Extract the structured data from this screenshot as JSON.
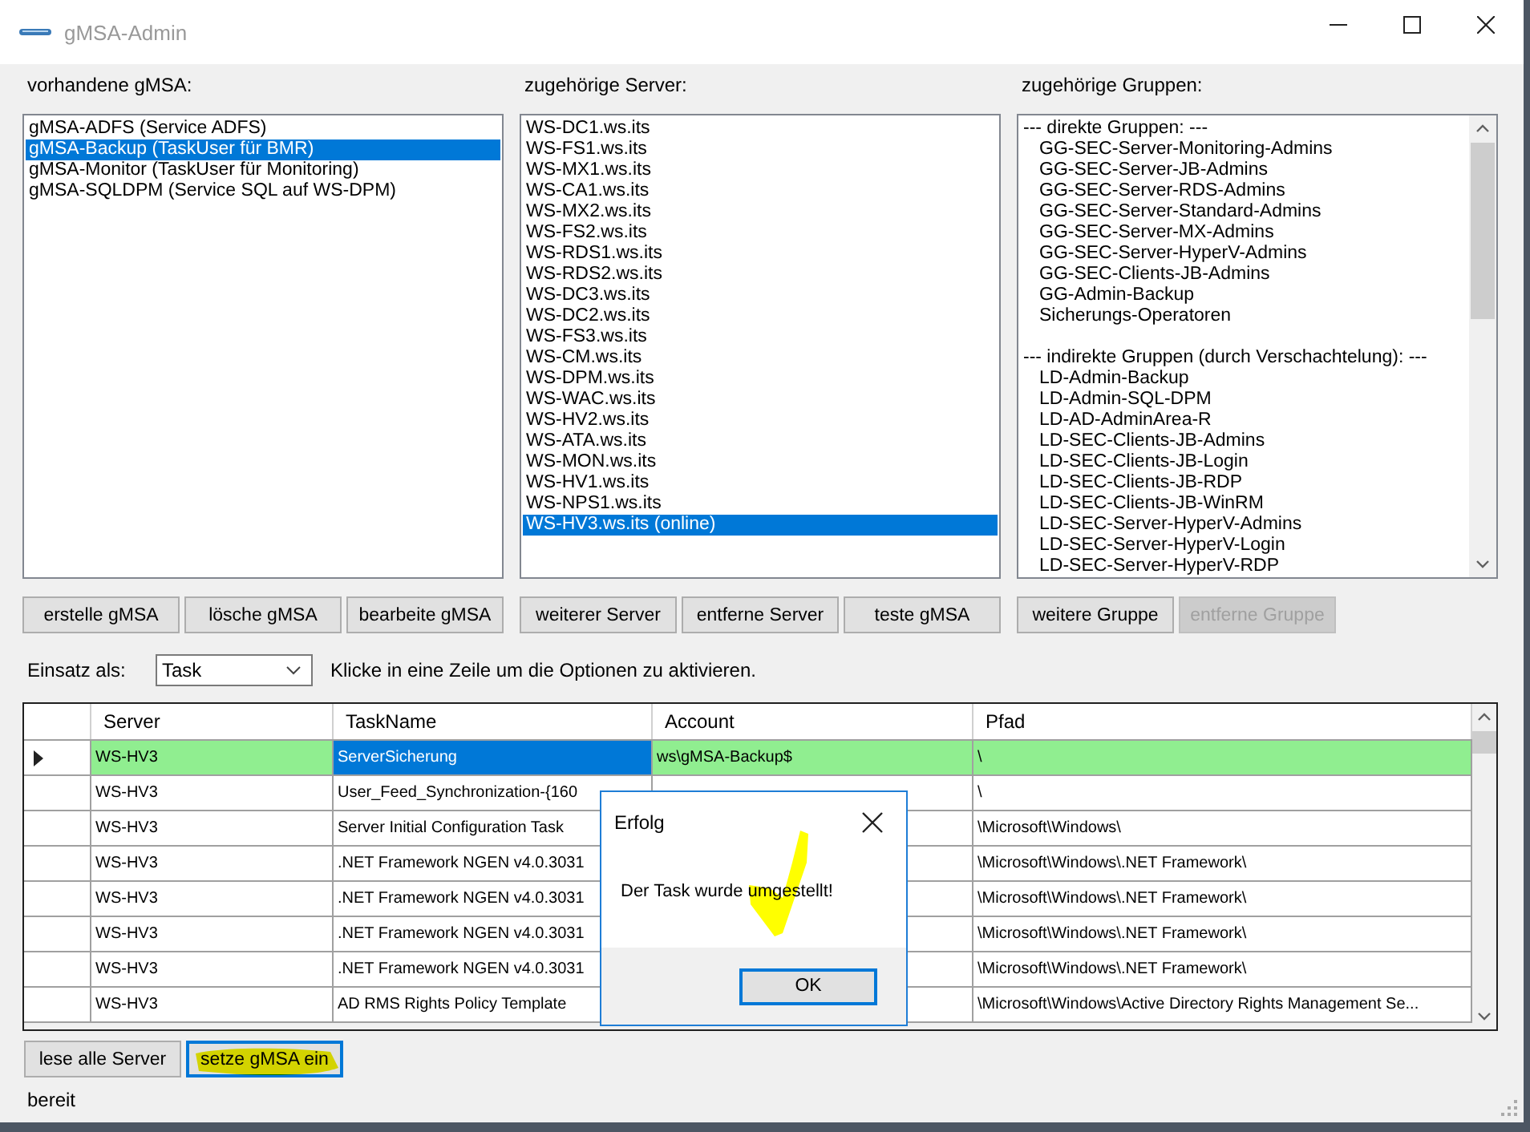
{
  "window": {
    "title": "gMSA-Admin"
  },
  "gmsa": {
    "label": "vorhandene gMSA:",
    "items": [
      {
        "text": "gMSA-ADFS (Service ADFS)",
        "selected": false
      },
      {
        "text": "gMSA-Backup (TaskUser für BMR)",
        "selected": true
      },
      {
        "text": "gMSA-Monitor (TaskUser für Monitoring)",
        "selected": false
      },
      {
        "text": "gMSA-SQLDPM (Service SQL auf WS-DPM)",
        "selected": false
      }
    ],
    "buttons": [
      {
        "label": "erstelle gMSA",
        "disabled": false
      },
      {
        "label": "lösche gMSA",
        "disabled": false
      },
      {
        "label": "bearbeite gMSA",
        "disabled": false
      }
    ]
  },
  "servers": {
    "label": "zugehörige Server:",
    "items": [
      {
        "text": "WS-DC1.ws.its",
        "selected": false
      },
      {
        "text": "WS-FS1.ws.its",
        "selected": false
      },
      {
        "text": "WS-MX1.ws.its",
        "selected": false
      },
      {
        "text": "WS-CA1.ws.its",
        "selected": false
      },
      {
        "text": "WS-MX2.ws.its",
        "selected": false
      },
      {
        "text": "WS-FS2.ws.its",
        "selected": false
      },
      {
        "text": "WS-RDS1.ws.its",
        "selected": false
      },
      {
        "text": "WS-RDS2.ws.its",
        "selected": false
      },
      {
        "text": "WS-DC3.ws.its",
        "selected": false
      },
      {
        "text": "WS-DC2.ws.its",
        "selected": false
      },
      {
        "text": "WS-FS3.ws.its",
        "selected": false
      },
      {
        "text": "WS-CM.ws.its",
        "selected": false
      },
      {
        "text": "WS-DPM.ws.its",
        "selected": false
      },
      {
        "text": "WS-WAC.ws.its",
        "selected": false
      },
      {
        "text": "WS-HV2.ws.its",
        "selected": false
      },
      {
        "text": "WS-ATA.ws.its",
        "selected": false
      },
      {
        "text": "WS-MON.ws.its",
        "selected": false
      },
      {
        "text": "WS-HV1.ws.its",
        "selected": false
      },
      {
        "text": "WS-NPS1.ws.its",
        "selected": false
      },
      {
        "text": "WS-HV3.ws.its (online)",
        "selected": true
      }
    ],
    "buttons": [
      {
        "label": "weiterer Server",
        "disabled": false
      },
      {
        "label": "entferne Server",
        "disabled": false
      },
      {
        "label": "teste gMSA",
        "disabled": false
      }
    ]
  },
  "groups": {
    "label": "zugehörige Gruppen:",
    "items": [
      {
        "text": "--- direkte Gruppen: ---",
        "children": [
          {
            "text": "GG-SEC-Server-Monitoring-Admins"
          },
          {
            "text": "GG-SEC-Server-JB-Admins"
          },
          {
            "text": "GG-SEC-Server-RDS-Admins"
          },
          {
            "text": "GG-SEC-Server-Standard-Admins"
          },
          {
            "text": "GG-SEC-Server-MX-Admins"
          },
          {
            "text": "GG-SEC-Server-HyperV-Admins"
          },
          {
            "text": "GG-SEC-Clients-JB-Admins"
          },
          {
            "text": "GG-Admin-Backup"
          },
          {
            "text": "Sicherungs-Operatoren"
          }
        ]
      },
      {
        "text": "--- indirekte Gruppen (durch Verschachtelung): ---",
        "children": [
          {
            "text": "LD-Admin-Backup"
          },
          {
            "text": "LD-Admin-SQL-DPM"
          },
          {
            "text": "LD-AD-AdminArea-R"
          },
          {
            "text": "LD-SEC-Clients-JB-Admins"
          },
          {
            "text": "LD-SEC-Clients-JB-Login"
          },
          {
            "text": "LD-SEC-Clients-JB-RDP"
          },
          {
            "text": "LD-SEC-Clients-JB-WinRM"
          },
          {
            "text": "LD-SEC-Server-HyperV-Admins"
          },
          {
            "text": "LD-SEC-Server-HyperV-Login"
          },
          {
            "text": "LD-SEC-Server-HyperV-RDP"
          }
        ]
      }
    ],
    "buttons": [
      {
        "label": "weitere Gruppe",
        "disabled": false
      },
      {
        "label": "entferne Gruppe",
        "disabled": true
      }
    ]
  },
  "usage": {
    "label": "Einsatz als:",
    "value": "Task",
    "hint": "Klicke in eine Zeile um die Optionen zu aktivieren."
  },
  "table": {
    "columns": [
      "Server",
      "TaskName",
      "Account",
      "Pfad"
    ],
    "rows": [
      {
        "selected": true,
        "cells": [
          {
            "text": "WS-HV3",
            "focused": false
          },
          {
            "text": "ServerSicherung",
            "focused": true
          },
          {
            "text": "ws\\gMSA-Backup$",
            "focused": false
          },
          {
            "text": "\\",
            "focused": false
          }
        ]
      },
      {
        "selected": false,
        "cells": [
          {
            "text": "WS-HV3",
            "focused": false
          },
          {
            "text": "User_Feed_Synchronization-{160",
            "focused": false
          },
          null,
          {
            "text": "\\",
            "focused": false
          }
        ]
      },
      {
        "selected": false,
        "cells": [
          {
            "text": "WS-HV3",
            "focused": false
          },
          {
            "text": "Server Initial Configuration Task",
            "focused": false
          },
          null,
          {
            "text": "\\Microsoft\\Windows\\",
            "focused": false
          }
        ]
      },
      {
        "selected": false,
        "cells": [
          {
            "text": "WS-HV3",
            "focused": false
          },
          {
            "text": ".NET Framework NGEN v4.0.3031",
            "focused": false
          },
          null,
          {
            "text": "\\Microsoft\\Windows\\.NET Framework\\",
            "focused": false
          }
        ]
      },
      {
        "selected": false,
        "cells": [
          {
            "text": "WS-HV3",
            "focused": false
          },
          {
            "text": ".NET Framework NGEN v4.0.3031",
            "focused": false
          },
          null,
          {
            "text": "\\Microsoft\\Windows\\.NET Framework\\",
            "focused": false
          }
        ]
      },
      {
        "selected": false,
        "cells": [
          {
            "text": "WS-HV3",
            "focused": false
          },
          {
            "text": ".NET Framework NGEN v4.0.3031",
            "focused": false
          },
          null,
          {
            "text": "\\Microsoft\\Windows\\.NET Framework\\",
            "focused": false
          }
        ]
      },
      {
        "selected": false,
        "cells": [
          {
            "text": "WS-HV3",
            "focused": false
          },
          {
            "text": ".NET Framework NGEN v4.0.3031",
            "focused": false
          },
          null,
          {
            "text": "\\Microsoft\\Windows\\.NET Framework\\",
            "focused": false
          }
        ]
      },
      {
        "selected": false,
        "cells": [
          {
            "text": "WS-HV3",
            "focused": false
          },
          {
            "text": "AD RMS Rights Policy Template",
            "focused": false
          },
          null,
          {
            "text": "\\Microsoft\\Windows\\Active Directory Rights Management Se...",
            "focused": false
          }
        ]
      }
    ]
  },
  "actions": [
    {
      "label": "lese alle Server",
      "focused": false
    },
    {
      "label": "setze gMSA ein",
      "focused": true
    }
  ],
  "status_bar": "bereit",
  "dialog": {
    "title": "Erfolg",
    "message": "Der Task wurde umgestellt!",
    "button": "OK"
  }
}
